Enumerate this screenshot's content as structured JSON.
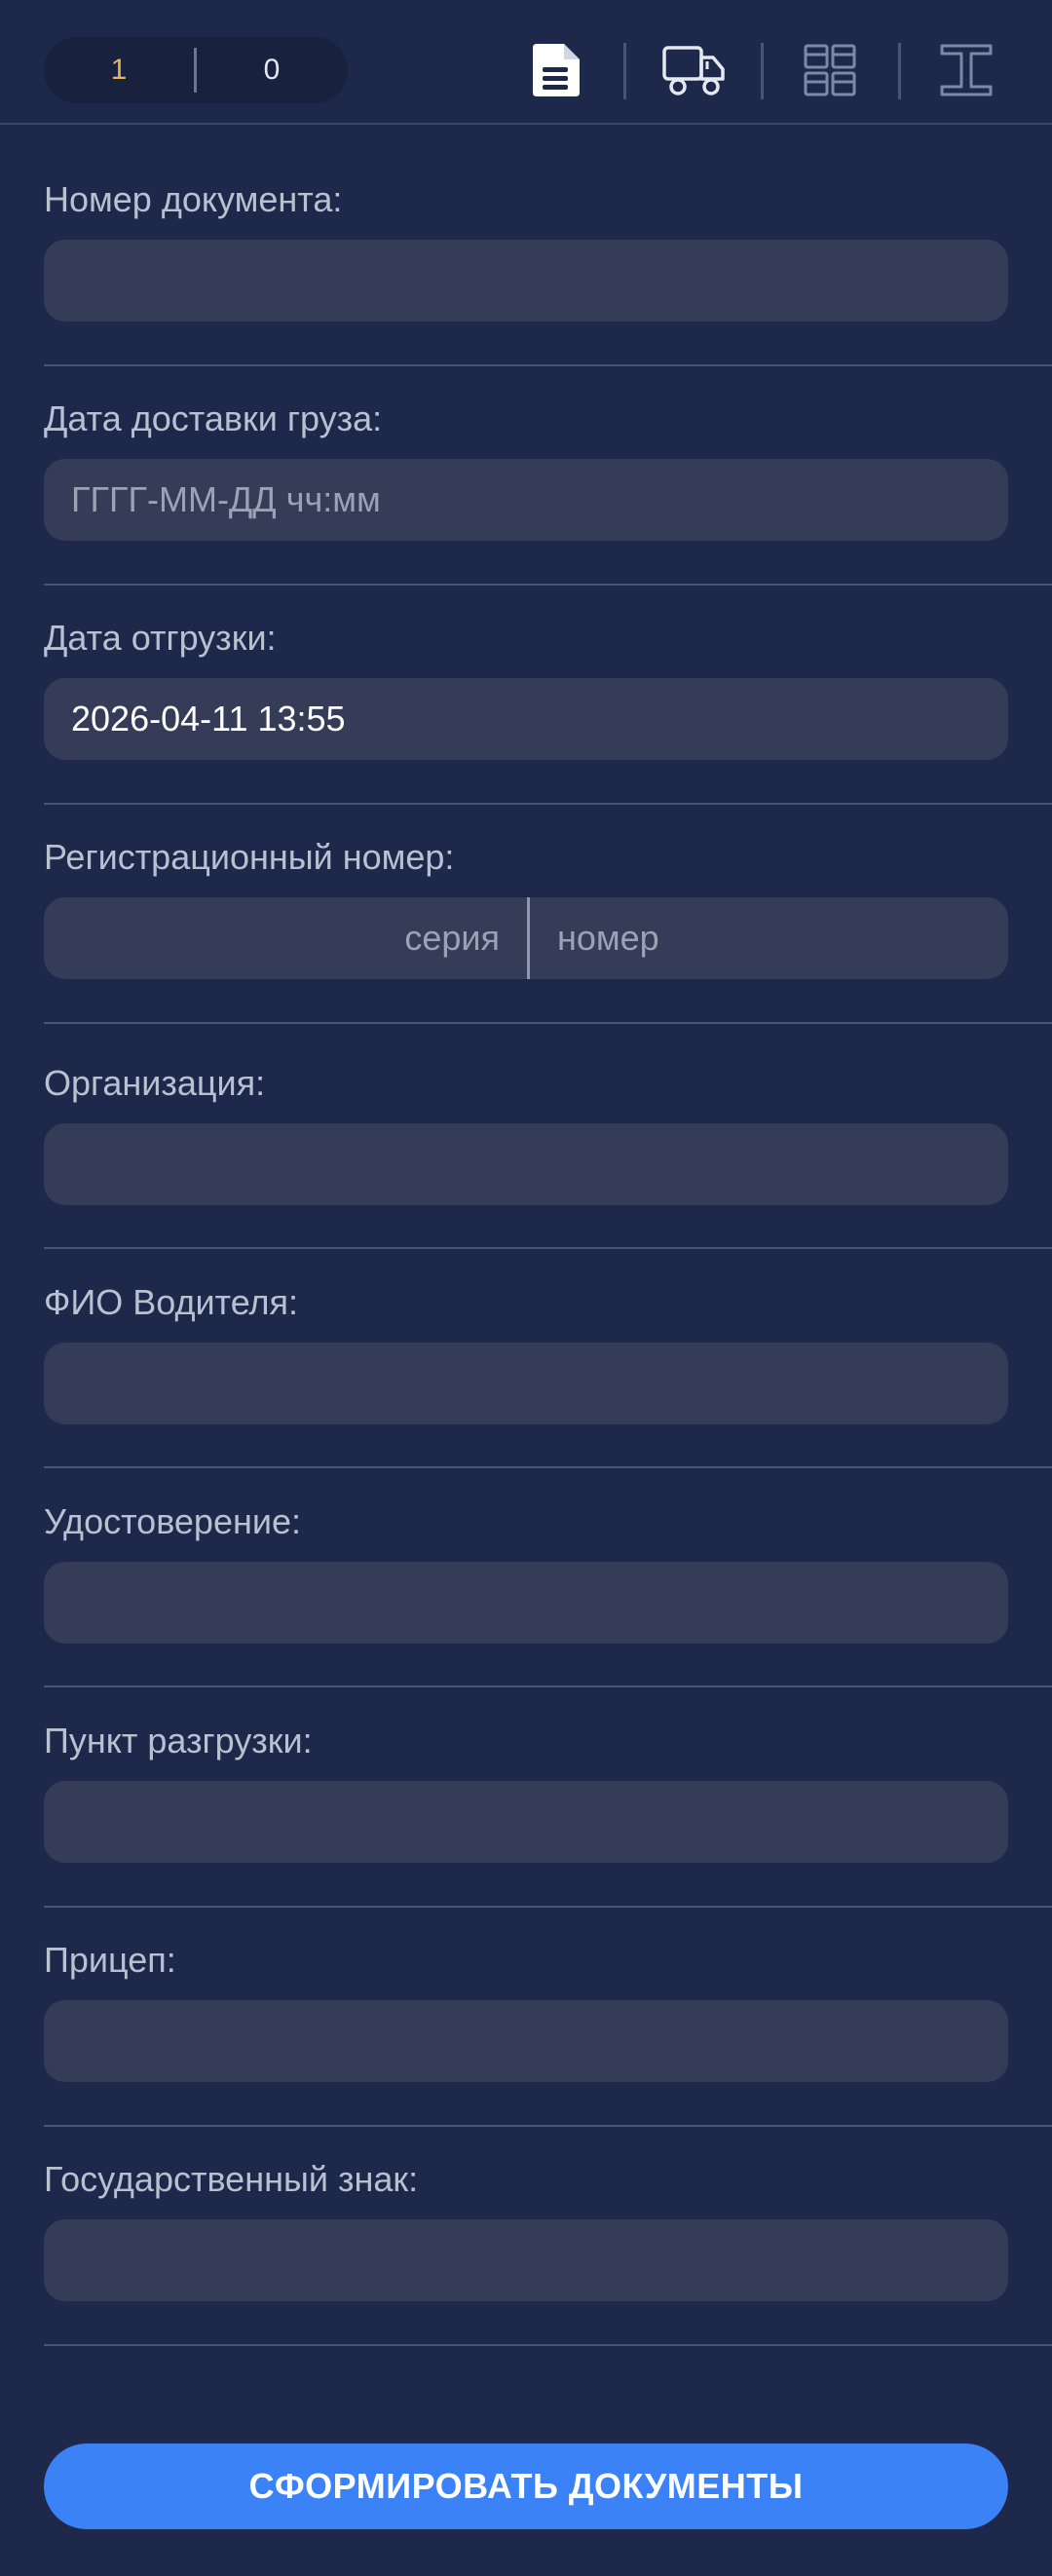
{
  "header": {
    "counter": {
      "first": "1",
      "second": "0"
    },
    "tabs": [
      {
        "icon": "document-icon",
        "active": true
      },
      {
        "icon": "truck-icon",
        "active": false
      },
      {
        "icon": "boxes-icon",
        "active": false
      },
      {
        "icon": "i-beam-icon",
        "active": false
      }
    ]
  },
  "form": {
    "document_number": {
      "label": "Номер документа:",
      "value": "",
      "placeholder": ""
    },
    "delivery_date": {
      "label": "Дата доставки груза:",
      "value": "",
      "placeholder": "ГГГГ-ММ-ДД чч:мм"
    },
    "shipment_date": {
      "label": "Дата отгрузки:",
      "value": "2026-04-11 13:55",
      "placeholder": ""
    },
    "registration_number": {
      "label": "Регистрационный номер:",
      "series_placeholder": "серия",
      "number_placeholder": "номер"
    },
    "organization": {
      "label": "Организация:",
      "value": ""
    },
    "driver_name": {
      "label": "ФИО Водителя:",
      "value": ""
    },
    "license": {
      "label": "Удостоверение:",
      "value": ""
    },
    "unloading_point": {
      "label": "Пункт разгрузки:",
      "value": ""
    },
    "trailer": {
      "label": "Прицеп:",
      "value": ""
    },
    "state_plate": {
      "label": "Государственный знак:",
      "value": ""
    }
  },
  "actions": {
    "submit_label": "СФОРМИРОВАТЬ ДОКУМЕНТЫ"
  },
  "colors": {
    "background": "#1e284a",
    "input_bg": "#343c58",
    "accent": "#3b82f6",
    "counter_active": "#e9b25a"
  }
}
